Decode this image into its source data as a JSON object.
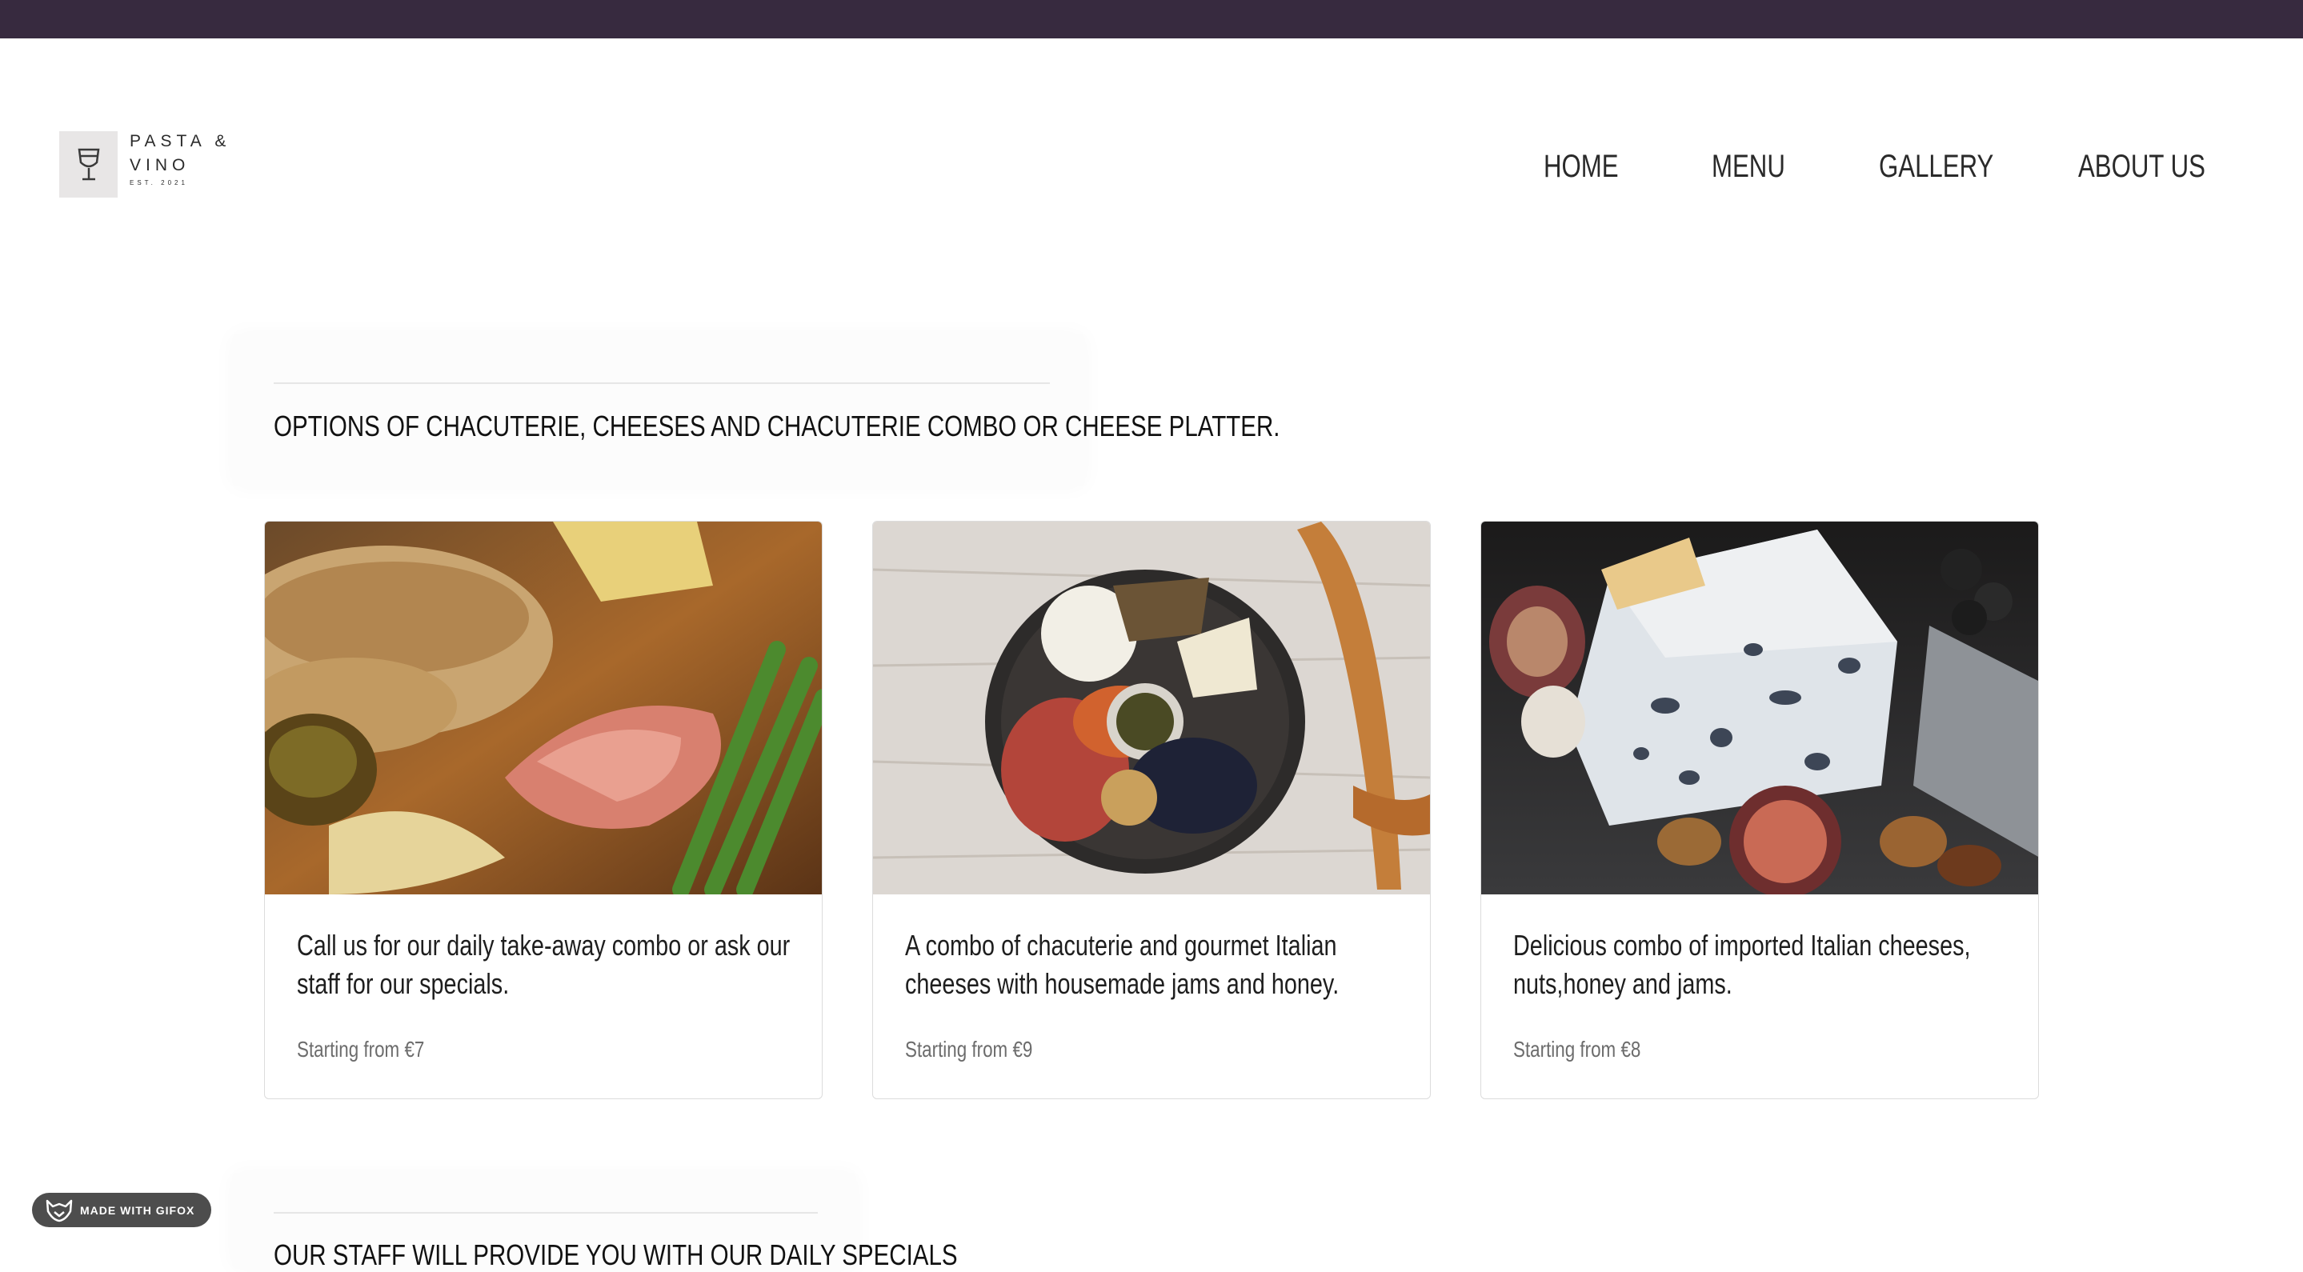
{
  "brand": {
    "line1": "PASTA &",
    "line2": "VINO",
    "est": "EST. 2021",
    "logo_icon": "wine-glass-icon"
  },
  "nav": {
    "home": "HOME",
    "menu": "MENU",
    "gallery": "GALLERY",
    "about": "ABOUT US"
  },
  "section": {
    "title": "OPTIONS OF CHACUTERIE, CHEESES AND CHACUTERIE COMBO OR CHEESE PLATTER."
  },
  "cards": [
    {
      "image": "bread-prosciutto-asparagus-photo",
      "description": "Call us for our daily take-away combo or ask our staff for our specials.",
      "price": "Starting from €7"
    },
    {
      "image": "charcuterie-board-baguette-photo",
      "description": "A combo of chacuterie and gourmet Italian cheeses with housemade jams and honey.",
      "price": "Starting from €9"
    },
    {
      "image": "blue-cheese-figs-walnuts-photo",
      "description": "Delicious combo of imported Italian cheeses, nuts,honey and jams.",
      "price": "Starting from €8"
    }
  ],
  "section2": {
    "title": "OUR STAFF WILL PROVIDE YOU WITH OUR DAILY SPECIALS"
  },
  "badge": {
    "label": "MADE WITH GIFOX",
    "icon": "fox-icon"
  },
  "colors": {
    "topbar": "#372a3f",
    "badge": "#4d4d4d"
  }
}
